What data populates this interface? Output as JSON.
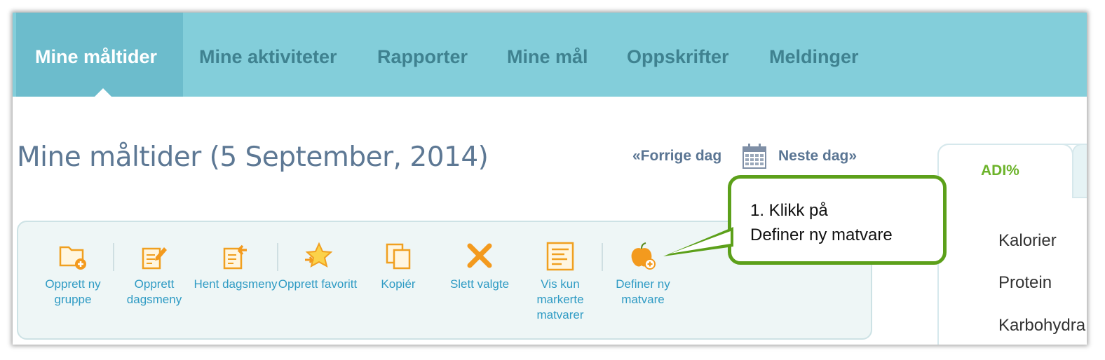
{
  "nav": {
    "items": [
      "Mine måltider",
      "Mine aktiviteter",
      "Rapporter",
      "Mine mål",
      "Oppskrifter",
      "Meldinger"
    ],
    "active_index": 0
  },
  "page": {
    "title": "Mine måltider (5 September, 2014)",
    "prev_day": "«Forrige dag",
    "next_day": "Neste dag»"
  },
  "toolbar": {
    "tools": [
      {
        "label": "Opprett ny gruppe",
        "icon": "folder-add-icon"
      },
      {
        "label": "Opprett dagsmeny",
        "icon": "edit-document-icon"
      },
      {
        "label": "Hent dagsmeny",
        "icon": "retrieve-document-icon"
      },
      {
        "label": "Opprett favoritt",
        "icon": "star-add-icon"
      },
      {
        "label": "Kopiér",
        "icon": "copy-icon"
      },
      {
        "label": "Slett valgte",
        "icon": "delete-x-icon"
      },
      {
        "label": "Vis kun markerte matvarer",
        "icon": "list-icon"
      },
      {
        "label": "Definer ny matvare",
        "icon": "apple-add-icon"
      }
    ]
  },
  "callout": {
    "line1": "1. Klikk på",
    "line2": "Definer ny matvare"
  },
  "right_panel": {
    "tab": "ADI%",
    "nutrients": [
      "Kalorier",
      "Protein",
      "Karbohydra"
    ]
  },
  "colors": {
    "nav_bg": "#83ceda",
    "nav_active": "#6cbccc",
    "link": "#2f9bc4",
    "callout_border": "#5ca01a",
    "adi": "#6cb32a"
  }
}
